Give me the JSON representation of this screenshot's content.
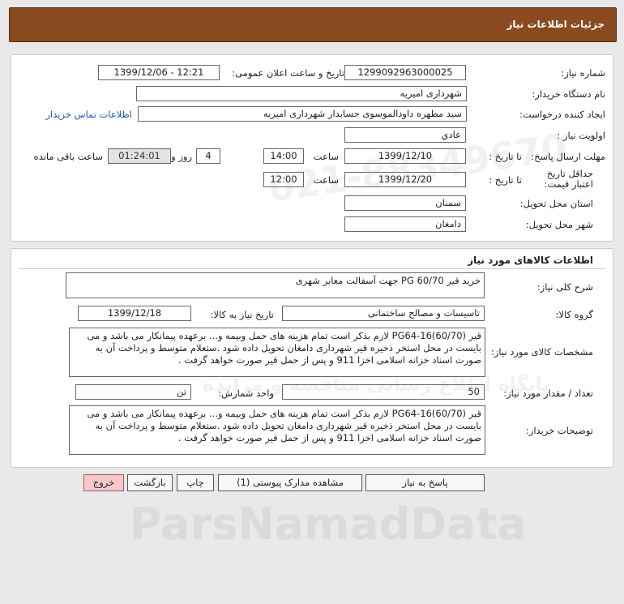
{
  "header": {
    "title": "جزئیات اطلاعات نیاز"
  },
  "info": {
    "need_number_label": "شماره نیاز:",
    "need_number_value": "1299092963000025",
    "announce_label": "تاریخ و ساعت اعلان عمومی:",
    "announce_value": "1399/12/06 - 12:21",
    "buyer_org_label": "نام دستگاه خریدار:",
    "buyer_org_value": "شهرداری امیریه",
    "requester_label": "ایجاد کننده درخواست:",
    "requester_value": "سید مطهره  داودالموسوی حسابدار شهرداری امیریه",
    "contact_link": "اطلاعات تماس خریدار",
    "priority_label": "اولویت نیاز :",
    "priority_value": "عادي",
    "reply_deadline_label": "مهلت ارسال پاسخ:",
    "to_date_label": "تا تاریخ :",
    "reply_date": "1399/12/10",
    "time_label": "ساعت",
    "reply_time": "14:00",
    "days_value": "4",
    "days_label": "روز و",
    "remaining_value": "01:24:01",
    "remaining_label": "ساعت باقی مانده",
    "price_validity_label": "حداقل تاریخ اعتبار قیمت:",
    "price_to_date_label": "تا تاریخ :",
    "price_date": "1399/12/20",
    "price_time_label": "ساعت",
    "price_time": "12:00",
    "province_label": "استان محل تحویل:",
    "province_value": "سمنان",
    "city_label": "شهر محل تحویل:",
    "city_value": "دامغان"
  },
  "goods": {
    "section_title": "اطلاعات کالاهای مورد نیاز",
    "summary_label": "شرح کلی نیاز:",
    "summary_value": "خرید قیر PG 60/70 جهت آسفالت معابر شهری",
    "group_label": "گروه کالا:",
    "group_value": "تاسیسات و مصالح ساختمانی",
    "need_date_label": "تاریخ نیاز به کالا:",
    "need_date_value": "1399/12/18",
    "specs_label": "مشخصات کالای مورد نیاز:",
    "specs_value": "قیر PG64-16(60/70) لازم بذکر است تمام هزینه های حمل وبیمه و... برعهده پیمانکار می باشد و می بایست در محل استخر ذخیره قیر شهرداری دامغان تحویل داده شود .ستعلام متوسط و پرداخت آن به صورت اسناد خزانه اسلامی اخزا 911 و پس از حمل قیر صورت خواهد گرفت .",
    "qty_label": "تعداد / مقدار مورد نیاز:",
    "qty_value": "50",
    "unit_label": "واحد شمارش:",
    "unit_value": "تن",
    "buyer_notes_label": "توضیحات خریدار:",
    "buyer_notes_value": "قیر PG64-16(60/70) لازم بذکر است تمام هزینه های حمل وبیمه و... برعهده پیمانکار می باشد و می بایست در محل استخر ذخیره قیر شهرداری دامغان تحویل داده شود .ستعلام متوسط و پرداخت آن به صورت اسناد خزانه اسلامی اخزا 911 و پس از حمل قیر صورت خواهد گرفت ."
  },
  "actions": {
    "reply": "پاسخ به نیاز",
    "attachments": "مشاهده مدارک پیوستی (1)",
    "print": "چاپ",
    "back": "بازگشت",
    "exit": "خروج"
  },
  "watermark": {
    "brand": "ParsNamadData",
    "phone": "021-88349670",
    "persian": "پایگاه اطلاع رسانی مناقصه و مزایده"
  }
}
